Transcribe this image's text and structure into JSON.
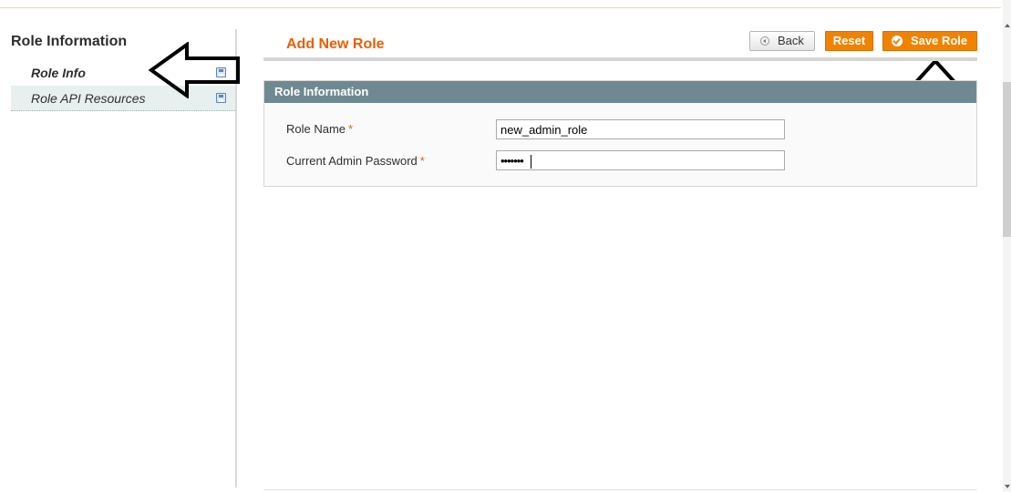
{
  "sidebar": {
    "title": "Role Information",
    "items": [
      {
        "label": "Role Info",
        "active": true,
        "icon": "save-icon"
      },
      {
        "label": "Role API Resources",
        "active": false,
        "icon": "save-icon"
      }
    ]
  },
  "main": {
    "title": "Add New Role",
    "buttons": {
      "back": "Back",
      "reset": "Reset",
      "save": "Save Role"
    },
    "section": {
      "title": "Role Information",
      "fields": [
        {
          "label": "Role Name",
          "required_mark": "*",
          "value": "new_admin_role"
        },
        {
          "label": "Current Admin Password",
          "required_mark": "*",
          "value": "•••••••"
        }
      ]
    }
  },
  "colors": {
    "accent": "#eb5e00",
    "button": "#f18200",
    "section_header": "#6f8992"
  }
}
